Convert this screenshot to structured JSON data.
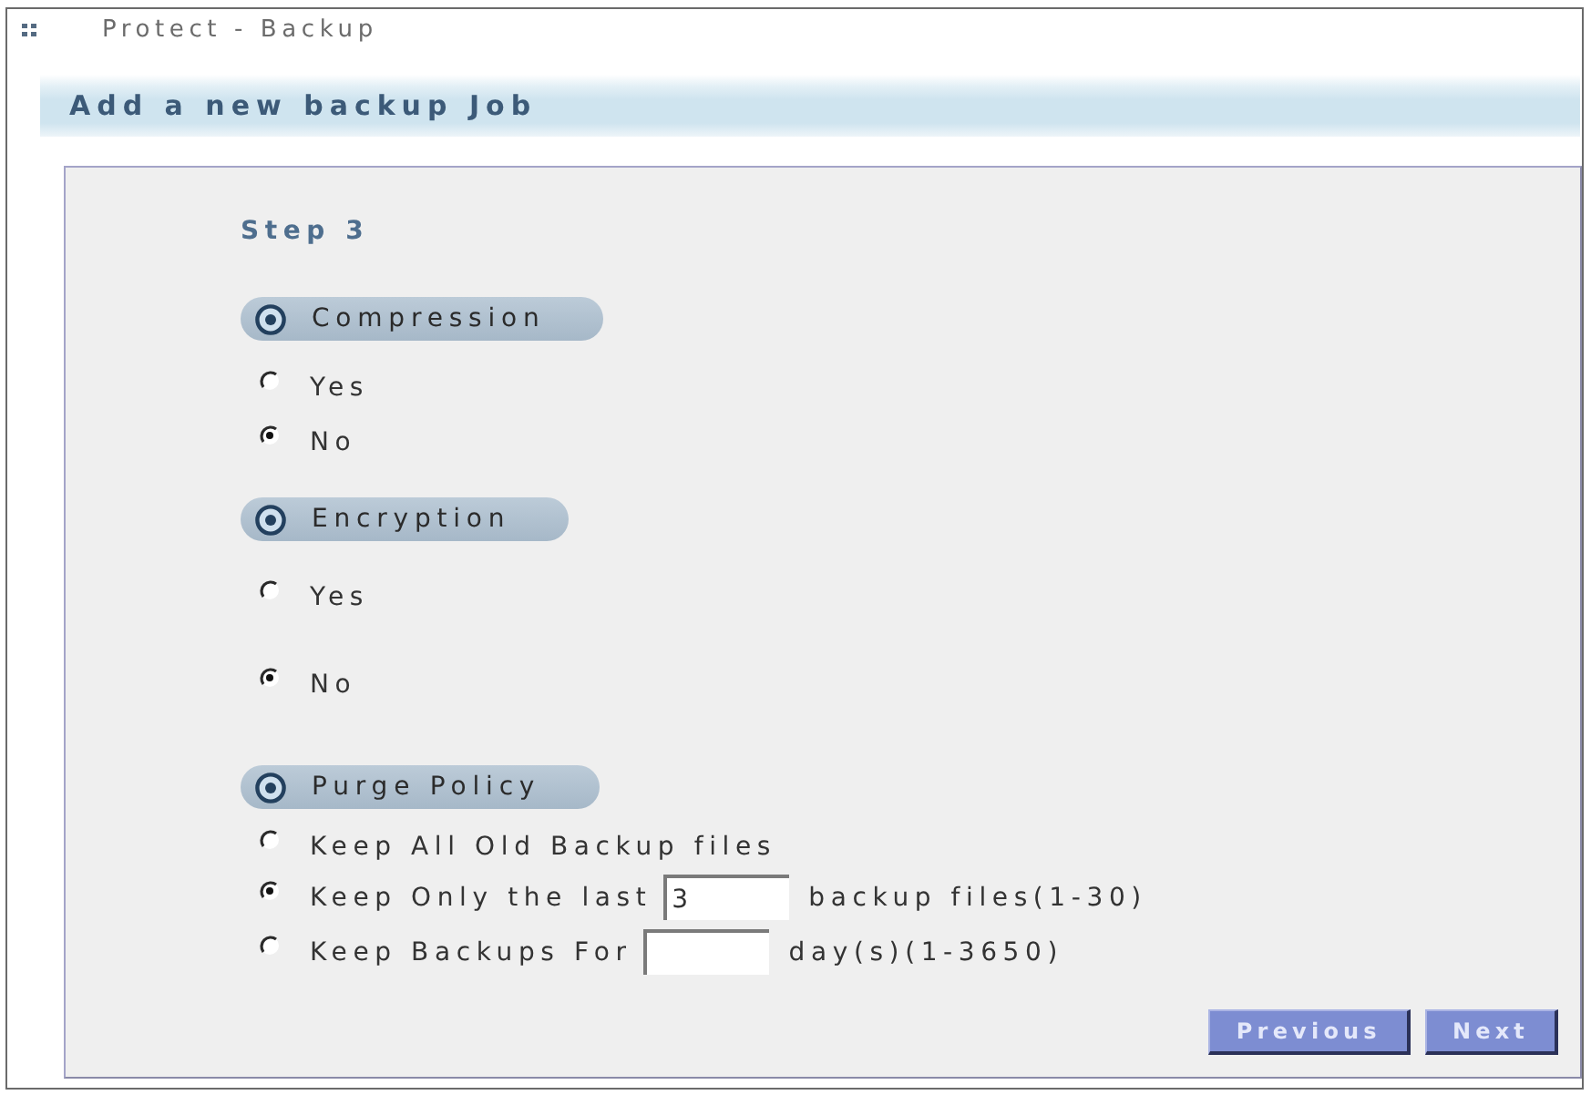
{
  "window": {
    "title": "Protect - Backup"
  },
  "header": {
    "title": "Add a new backup Job"
  },
  "form": {
    "step": "Step 3",
    "sections": [
      {
        "title": "Compression",
        "options": [
          {
            "kind": "plain",
            "label": "Yes",
            "selected": false
          },
          {
            "kind": "plain",
            "label": "No",
            "selected": true
          }
        ]
      },
      {
        "title": "Encryption",
        "options": [
          {
            "kind": "plain",
            "label": "Yes",
            "selected": false
          },
          {
            "kind": "plain",
            "label": "No",
            "selected": true
          }
        ]
      },
      {
        "title": "Purge Policy",
        "options": [
          {
            "kind": "plain",
            "label": "Keep All Old Backup files",
            "selected": false
          },
          {
            "kind": "input",
            "label": "Keep Only the last",
            "value": "3",
            "suffix": "backup files(1-30)",
            "selected": true
          },
          {
            "kind": "input",
            "label": "Keep Backups For",
            "suffix": "day(s)(1-3650)",
            "selected": false
          }
        ]
      }
    ],
    "buttons": [
      {
        "label": "Previous"
      },
      {
        "label": "Next"
      }
    ]
  }
}
